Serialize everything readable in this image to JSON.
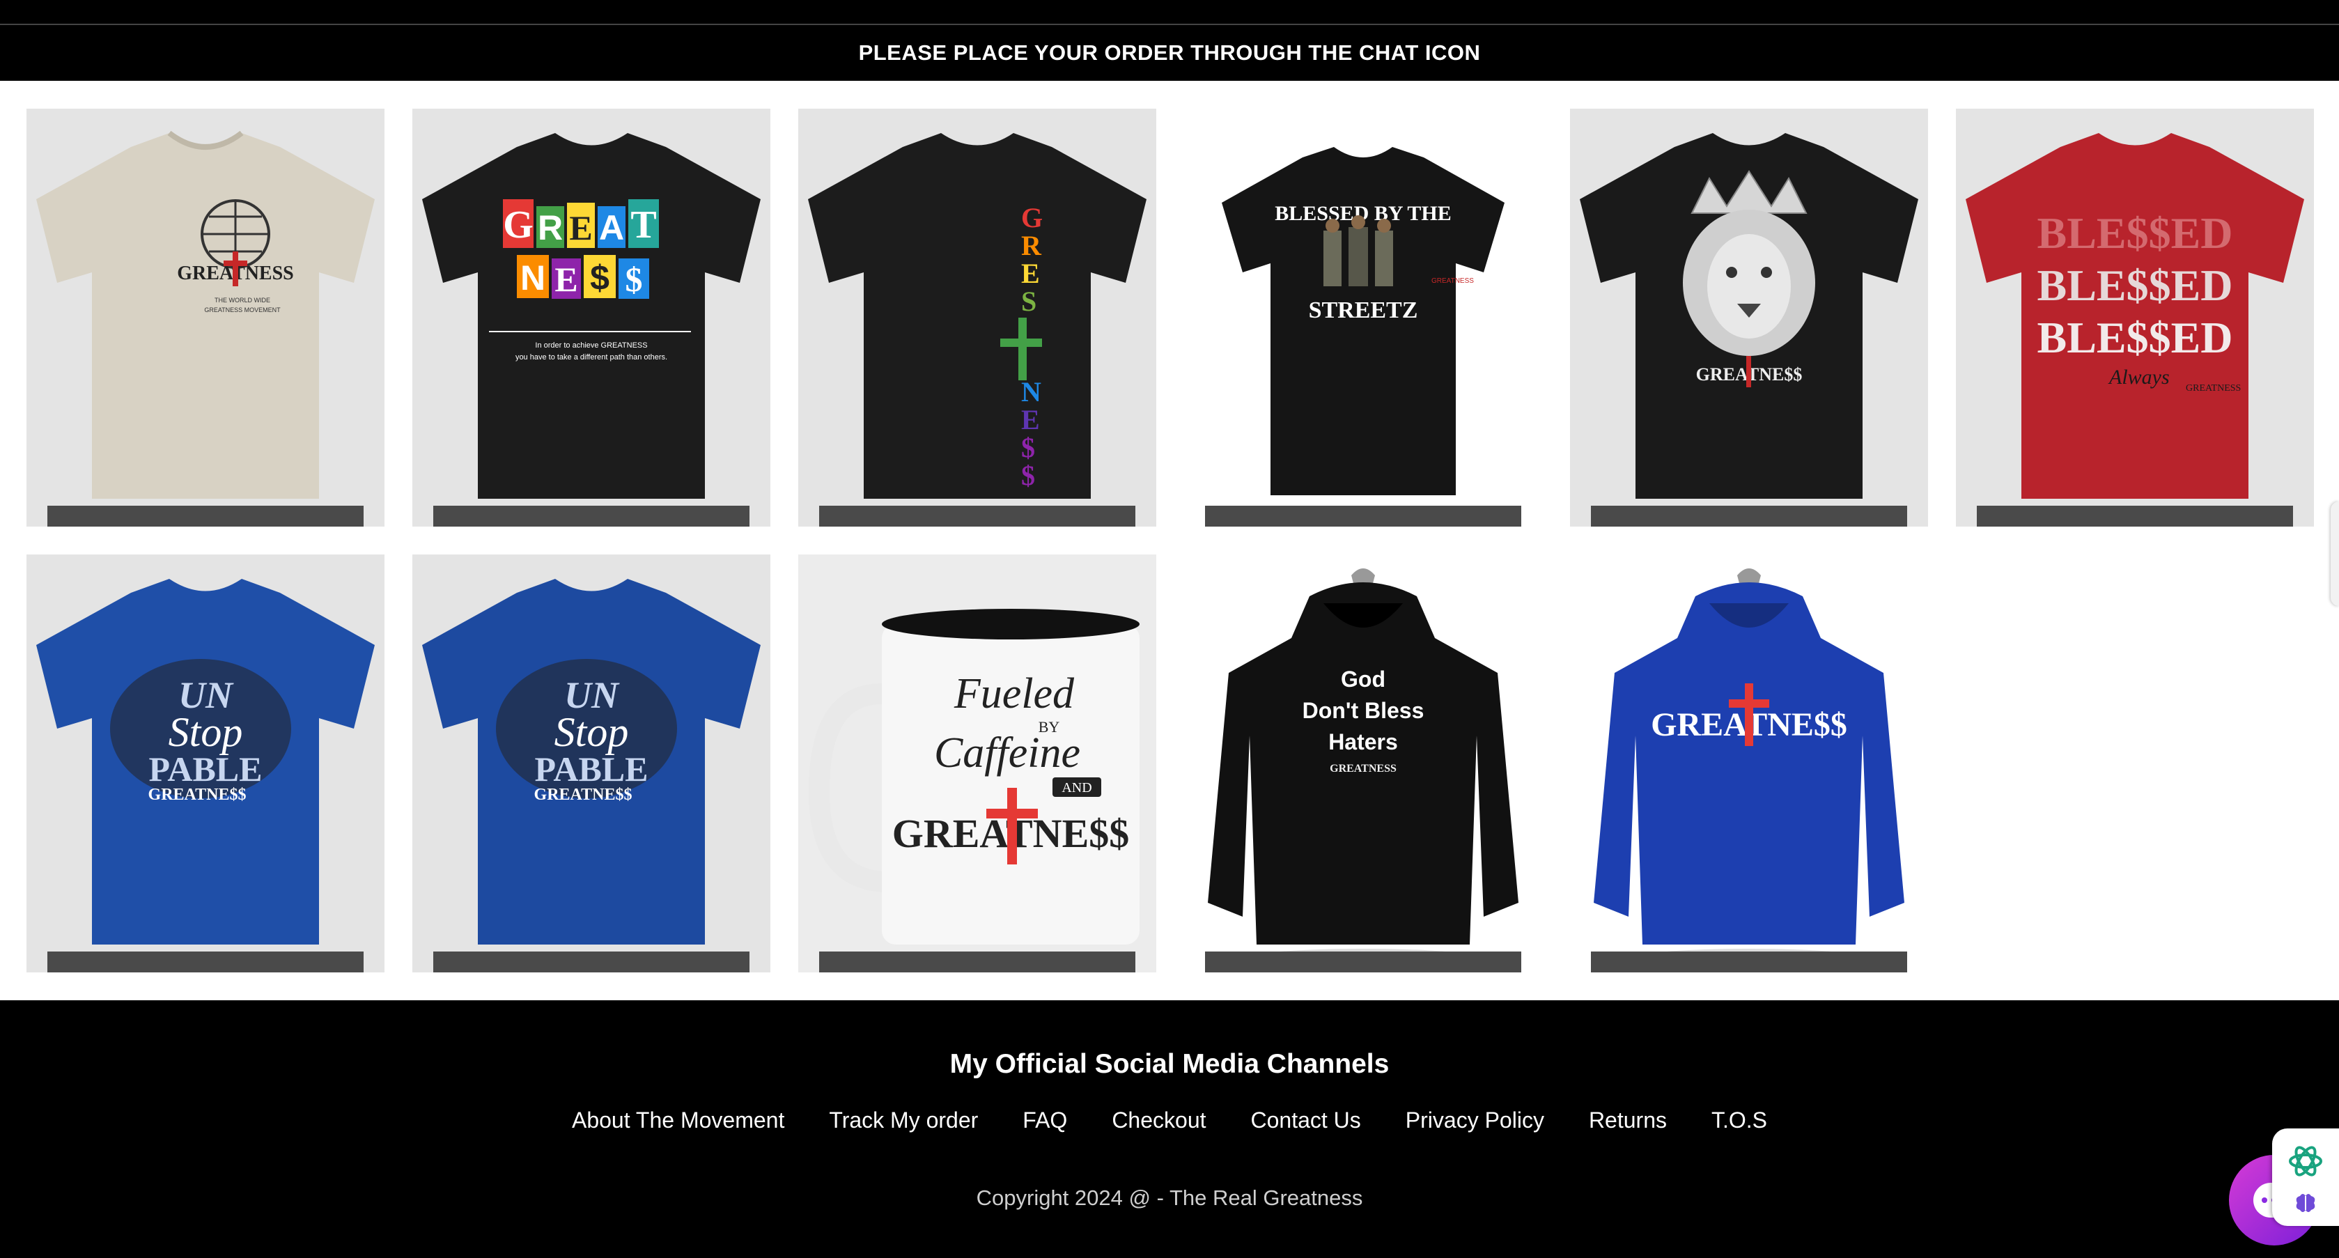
{
  "announcement": {
    "text": "PLEASE PLACE YOUR ORDER THROUGH THE CHAT ICON"
  },
  "products": [
    {
      "name": "Greatness world wide movement tee",
      "color": "#d8d2c4",
      "graphic": "GREATNESS",
      "sub": "THE WORLD WIDE GREATNESS MOVEMENT"
    },
    {
      "name": "Greatness ransom letter tee",
      "color": "#1c1c1c",
      "graphic": "GREAT NE$$",
      "sub": "In order to achieve GREATNESS you have to take a different path than others."
    },
    {
      "name": "Greatness rainbow vertical tee",
      "color": "#1c1c1c",
      "graphic": "GREATNE$$"
    },
    {
      "name": "Blessed by the streetz tee",
      "color": "#151515",
      "graphic": "BLESSED BY THE",
      "graphic2": "STREETZ"
    },
    {
      "name": "Lion crown greatness tee",
      "color": "#1a1a1a",
      "graphic": "GREATNE$$"
    },
    {
      "name": "Blessed red tee",
      "color": "#b8232c",
      "graphic": "BLE$$ED"
    },
    {
      "name": "Unstoppable blue tee",
      "color": "#1f4fa8",
      "graphic": "UN Stop PABLE",
      "sub": "GREATNE$$"
    },
    {
      "name": "Unstoppable blue tee 2",
      "color": "#1f4fa8",
      "graphic": "UN Stop PABLE",
      "sub": "GREATNE$$"
    },
    {
      "name": "Fueled by caffeine mug",
      "color": "#f7f7f7",
      "graphic": "Fueled BY Caffeine AND",
      "sub": "GREATNE$$"
    },
    {
      "name": "God don't bless haters hoodie",
      "color": "#111111",
      "graphic": "God",
      "graphic2": "Don't Bless",
      "graphic3": "Haters",
      "sub": "GREATNESS"
    },
    {
      "name": "Greatness blue hoodie",
      "color": "#1d3fb0",
      "graphic": "GREATNE$$"
    }
  ],
  "footer": {
    "title": "My Official Social Media Channels",
    "links": [
      "About The Movement",
      "Track My order",
      "FAQ",
      "Checkout",
      "Contact Us",
      "Privacy Policy",
      "Returns",
      "T.O.S"
    ],
    "copyright": "Copyright 2024 @ - The Real Greatness"
  },
  "icons": {
    "chat": "chat-bubble-icon",
    "ai": "openai-knot-icon",
    "brain": "brain-icon"
  },
  "colors": {
    "accent": "#c02bd0",
    "footer_bg": "#000000",
    "bar": "#4a4a4a"
  }
}
